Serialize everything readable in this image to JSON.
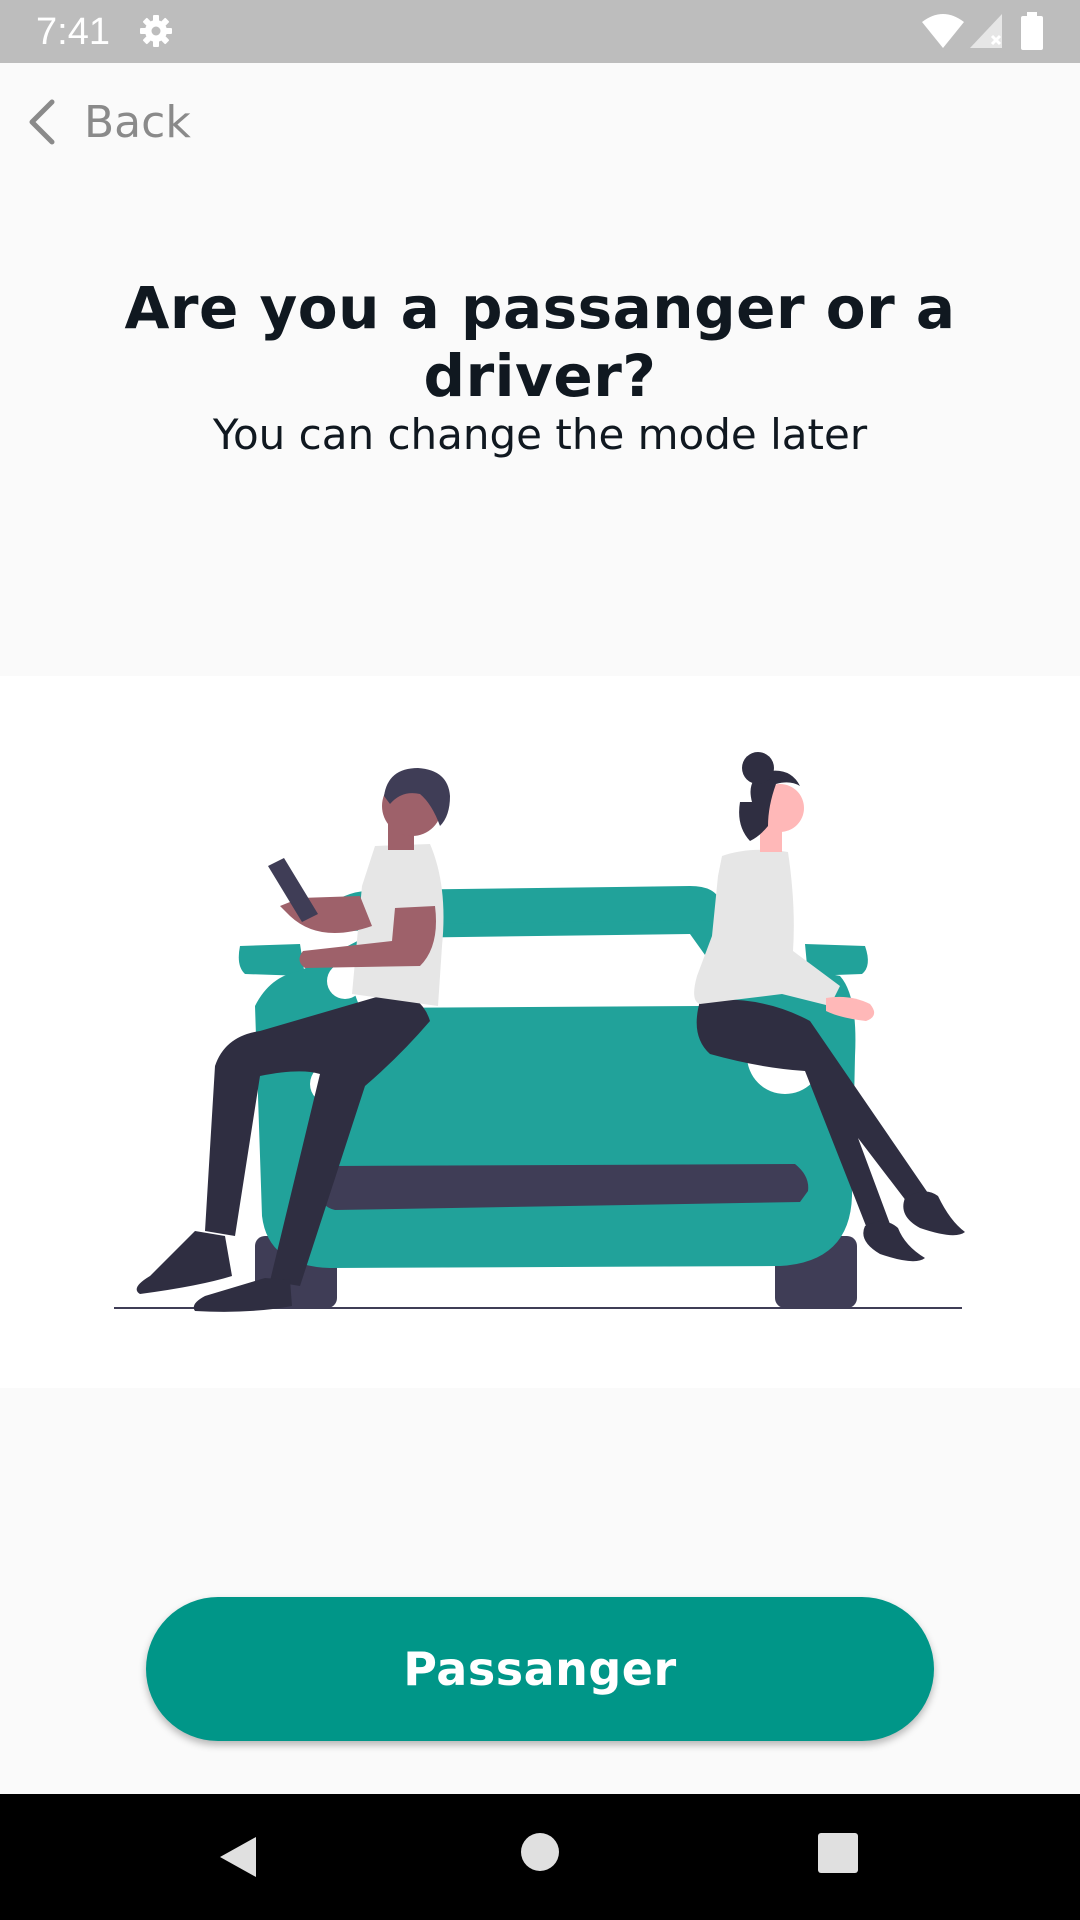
{
  "status_bar": {
    "time": "7:41",
    "icons": [
      "gear-icon",
      "wifi-icon",
      "cell-signal-icon",
      "battery-icon"
    ]
  },
  "header": {
    "back_label": "Back"
  },
  "main": {
    "title": "Are you a passanger or a driver?",
    "subtitle": "You can change the mode later",
    "illustration": "couple-sitting-on-car-illustration"
  },
  "footer": {
    "primary_button_label": "Passanger"
  },
  "nav_bar": {
    "icons": [
      "nav-back-icon",
      "nav-home-icon",
      "nav-recents-icon"
    ]
  },
  "colors": {
    "accent": "#009688",
    "car": "#21a29a",
    "dark": "#3f3d56",
    "status_bar": "#bdbdbd",
    "background": "#fafafa"
  }
}
